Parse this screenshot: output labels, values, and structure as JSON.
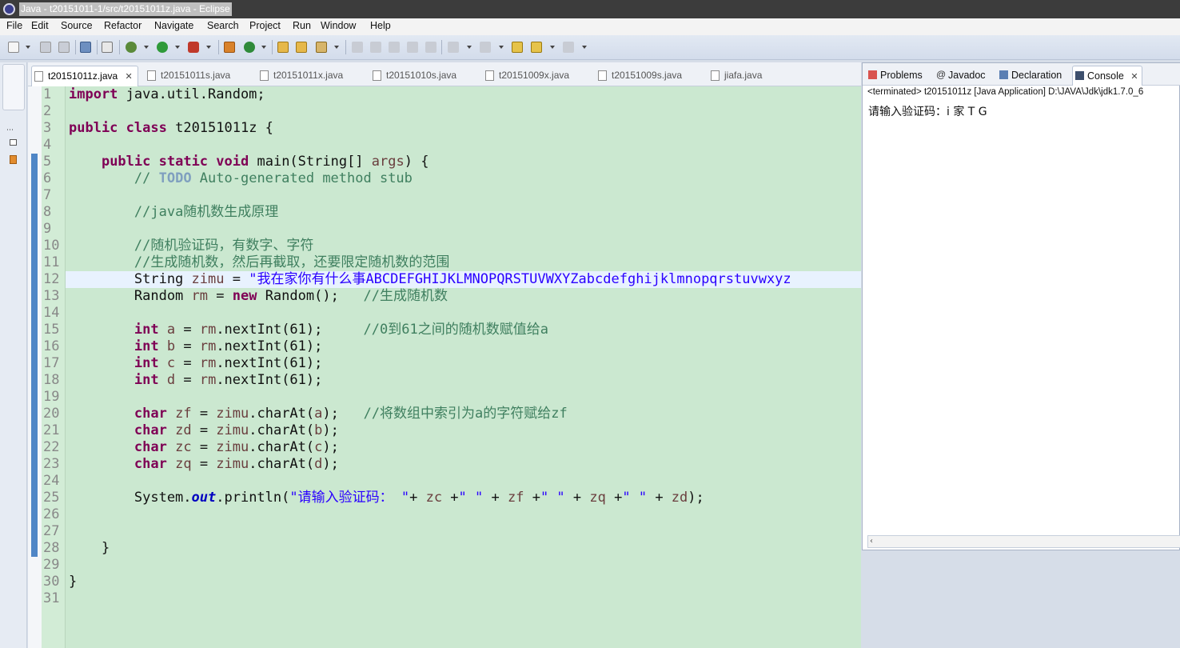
{
  "window": {
    "title": "Java - t20151011-1/src/t20151011z.java - Eclipse"
  },
  "menu": [
    "File",
    "Edit",
    "Source",
    "Refactor",
    "Navigate",
    "Search",
    "Project",
    "Run",
    "Window",
    "Help"
  ],
  "editor": {
    "tabs": [
      {
        "label": "t20151011z.java",
        "active": true
      },
      {
        "label": "t20151011s.java",
        "active": false
      },
      {
        "label": "t20151011x.java",
        "active": false
      },
      {
        "label": "t20151010s.java",
        "active": false
      },
      {
        "label": "t20151009x.java",
        "active": false
      },
      {
        "label": "t20151009s.java",
        "active": false
      },
      {
        "label": "jiafa.java",
        "active": false
      }
    ],
    "current_line": 12,
    "lines": [
      "import java.util.Random;",
      "",
      "public class t20151011z {",
      "",
      "    public static void main(String[] args) {",
      "        // TODO Auto-generated method stub",
      "",
      "        //java随机数生成原理",
      "",
      "        //随机验证码，有数字、字符",
      "        //生成随机数，然后再截取，还要限定随机数的范围",
      "        String zimu = \"我在家你有什么事ABCDEFGHIJKLMNOPQRSTUVWXYZabcdefghijklmnopqrstuvwxyz",
      "        Random rm = new Random();   //生成随机数",
      "",
      "        int a = rm.nextInt(61);     //0到61之间的随机数赋值给a",
      "        int b = rm.nextInt(61);",
      "        int c = rm.nextInt(61);",
      "        int d = rm.nextInt(61);",
      "",
      "        char zf = zimu.charAt(a);   //将数组中索引为a的字符赋给zf",
      "        char zd = zimu.charAt(b);",
      "        char zc = zimu.charAt(c);",
      "        char zq = zimu.charAt(d);",
      "",
      "        System.out.println(\"请输入验证码： \"+ zc +\" \" + zf +\" \" + zq +\" \" + zd);",
      "",
      "",
      "    }",
      "",
      "}",
      ""
    ]
  },
  "panel": {
    "tabs": [
      {
        "label": "Problems",
        "active": false
      },
      {
        "label": "Javadoc",
        "active": false
      },
      {
        "label": "Declaration",
        "active": false
      },
      {
        "label": "Console",
        "active": true
      }
    ],
    "console_status": "<terminated> t20151011z [Java Application] D:\\JAVA\\Jdk\\jdk1.7.0_6",
    "console_output": "请输入验证码：i 家 T G"
  },
  "colors": {
    "editor_bg": "#cbe8d0",
    "keyword": "#7f0055",
    "string": "#2a00ff",
    "comment": "#3f7f5f"
  }
}
